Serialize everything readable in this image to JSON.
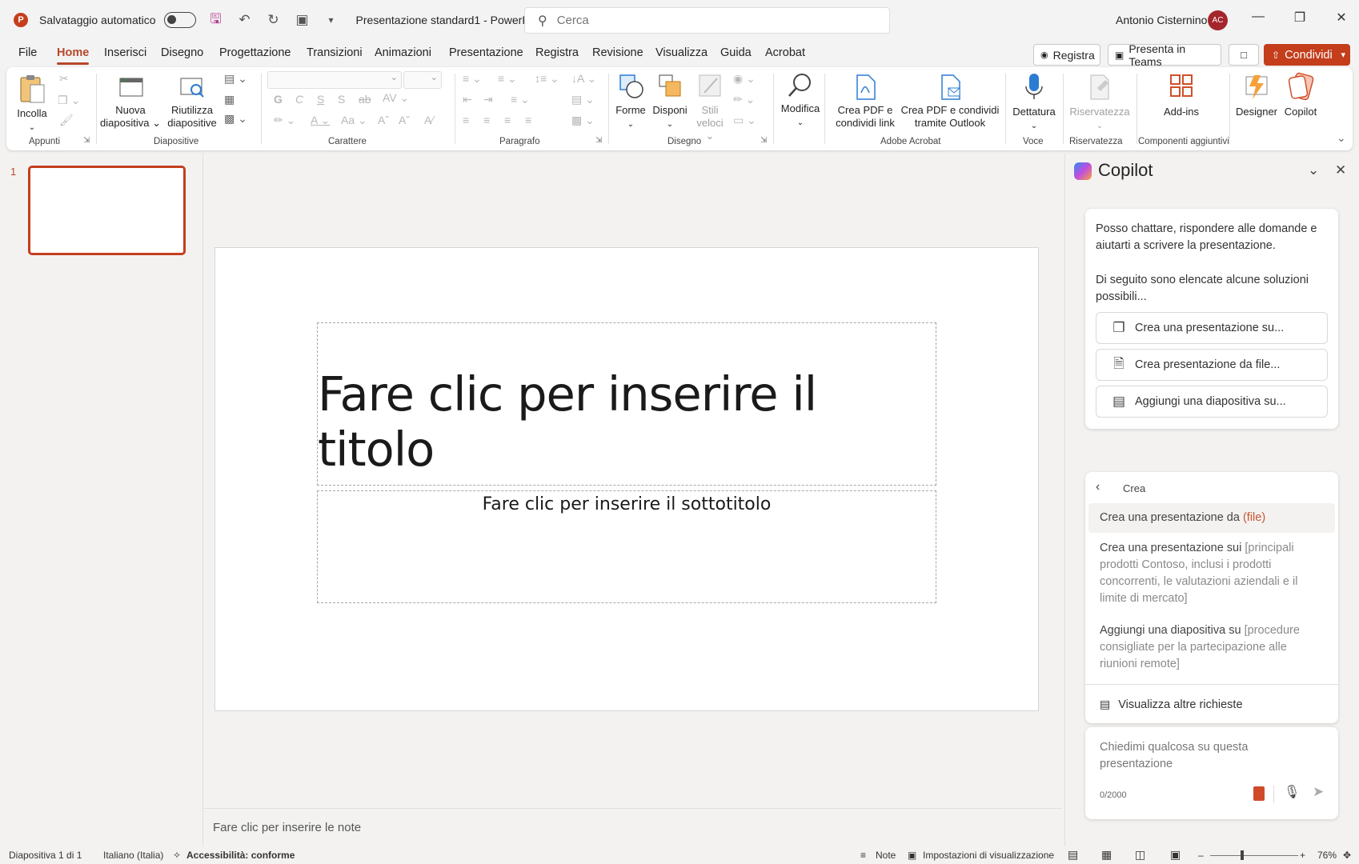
{
  "titlebar": {
    "app_letter": "P",
    "autosave_label": "Salvataggio automatico",
    "doc_title": "Presentazione standard1  -  PowerP...",
    "search_placeholder": "Cerca",
    "user_name": "Antonio Cisternino",
    "avatar_initials": "AC"
  },
  "menu": {
    "tabs": [
      "File",
      "Home",
      "Inserisci",
      "Disegno",
      "Progettazione",
      "Transizioni",
      "Animazioni",
      "Presentazione",
      "Registra",
      "Revisione",
      "Visualizza",
      "Guida",
      "Acrobat"
    ],
    "active": "Home",
    "record_label": "Registra",
    "teams_label": "Presenta in Teams",
    "share_label": "Condividi"
  },
  "ribbon": {
    "paste": "Incolla",
    "new_slide_1": "Nuova",
    "new_slide_2": "diapositiva",
    "reuse_1": "Riutilizza",
    "reuse_2": "diapositive",
    "shapes": "Forme",
    "arrange": "Disponi",
    "quick_styles_1": "Stili",
    "quick_styles_2": "veloci",
    "edit": "Modifica",
    "pdf_link_1": "Crea PDF e",
    "pdf_link_2": "condividi link",
    "pdf_outlook_1": "Crea PDF e condividi",
    "pdf_outlook_2": "tramite Outlook",
    "dictate": "Dettatura",
    "sensitivity": "Riservatezza",
    "addins": "Add-ins",
    "designer": "Designer",
    "copilot": "Copilot",
    "groups": {
      "clipboard": "Appunti",
      "slides": "Diapositive",
      "font": "Carattere",
      "paragraph": "Paragrafo",
      "drawing": "Disegno",
      "acrobat": "Adobe Acrobat",
      "voice": "Voce",
      "sensitivity": "Riservatezza",
      "addins": "Componenti aggiuntivi"
    }
  },
  "thumbnails": {
    "slide_number": "1"
  },
  "slide": {
    "title_placeholder": "Fare clic per inserire il titolo",
    "subtitle_placeholder": "Fare clic per inserire il sottotitolo"
  },
  "notes": {
    "placeholder": "Fare clic per inserire le note"
  },
  "copilot": {
    "title": "Copilot",
    "intro_1": "Posso chattare, rispondere alle domande e aiutarti a scrivere la presentazione.",
    "intro_2": "Di seguito sono elencate alcune soluzioni possibili...",
    "suggestions": [
      "Crea una presentazione su...",
      "Crea presentazione da file...",
      "Aggiungi una diapositiva su..."
    ],
    "back_label": "Crea",
    "prompt_1_text": "Crea una presentazione da ",
    "prompt_1_ph": "(file)",
    "prompt_2_text": "Crea una presentazione sui ",
    "prompt_2_ph": "[principali prodotti Contoso, inclusi i prodotti concorrenti, le valutazioni aziendali e il limite di mercato]",
    "prompt_3_text": "Aggiungi una diapositiva su ",
    "prompt_3_ph": "[procedure consigliate per la partecipazione alle riunioni remote]",
    "more_prompts": "Visualizza altre richieste",
    "input_placeholder": "Chiedimi qualcosa su questa presentazione",
    "char_count": "0/2000"
  },
  "status": {
    "slide_info": "Diapositiva 1 di 1",
    "language": "Italiano (Italia)",
    "accessibility": "Accessibilità: conforme",
    "notes": "Note",
    "view_settings": "Impostazioni di visualizzazione",
    "zoom": "76%"
  },
  "colors": {
    "accent": "#c43e1c",
    "tab_active": "#b7472a",
    "save_icon": "#b7388f"
  }
}
